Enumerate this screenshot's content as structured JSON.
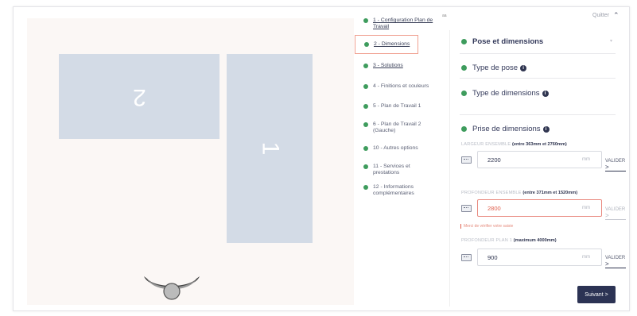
{
  "header": {
    "quit_label": "Quitter",
    "quit_icon": "chevron-up-icon",
    "corner_mark": "aa"
  },
  "canvas": {
    "pieces": [
      {
        "number": "2"
      },
      {
        "number": "1"
      }
    ],
    "chair_icon": "office-chair-icon"
  },
  "steps": [
    {
      "label": "1 - Configuration Plan de Travail",
      "link": true,
      "status": "done"
    },
    {
      "label": "2 - Dimensions",
      "link": true,
      "status": "active"
    },
    {
      "label": "3 - Solutions",
      "link": true,
      "status": "done"
    },
    {
      "label": "4 - Finitions et couleurs",
      "link": false,
      "status": "done"
    },
    {
      "label": "5 - Plan de Travail 1",
      "link": false,
      "status": "done"
    },
    {
      "label": "6 - Plan de Travail 2 (Gauche)",
      "link": false,
      "status": "done"
    },
    {
      "label": "10 - Autres options",
      "link": false,
      "status": "done"
    },
    {
      "label": "11 - Services et prestations",
      "link": false,
      "status": "done"
    },
    {
      "label": "12 - Informations complémentaires",
      "link": false,
      "status": "done"
    }
  ],
  "panel": {
    "title": "Pose et dimensions",
    "sections": {
      "type_pose": "Type de pose",
      "type_dimensions": "Type de dimensions",
      "prise_dimensions": "Prise de dimensions"
    },
    "fields": [
      {
        "label": "LARGEUR ENSEMBLE",
        "range": "(entre 363mm et 2760mm)",
        "value": "2200",
        "unit": "mm",
        "error": false
      },
      {
        "label": "PROFONDEUR ENSEMBLE",
        "range": "(entre 371mm et 1520mm)",
        "value": "2800",
        "unit": "mm",
        "error": true,
        "error_message": "Merci de vérifier votre saisie"
      },
      {
        "label": "PROFONDEUR PLAN 1",
        "range": "(maximum 4000mm)",
        "value": "900",
        "unit": "mm",
        "error": false
      }
    ],
    "valider_label": "VALIDER",
    "valider_arrow": ">",
    "next_label": "Suivant >"
  },
  "colors": {
    "accent": "#2c3354",
    "success": "#3e9c5d",
    "error": "#e0614f",
    "piece": "#d3dbe6",
    "canvas": "#fbf7f5"
  }
}
